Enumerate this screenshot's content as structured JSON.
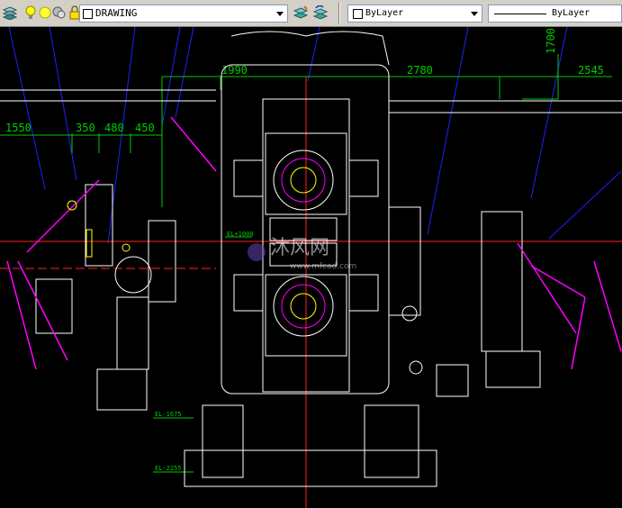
{
  "toolbar": {
    "layer_name": "DRAWING",
    "color_value": "ByLayer",
    "linetype_value": "ByLayer",
    "icons": [
      "layers-icon",
      "lightbulb-icon",
      "sun-icon",
      "freeze-viewport-icon",
      "lock-icon",
      "color-swatch-icon",
      "make-object-layer-current-icon",
      "layer-previous-icon",
      "dropdown-arrow-icon"
    ]
  },
  "drawing": {
    "dimensions": [
      "1550",
      "350",
      "480",
      "450",
      "1990",
      "2780",
      "2545",
      "1700"
    ],
    "elevation_labels": [
      "EL+1000",
      "EL-1675",
      "EL-2255"
    ],
    "watermark_text": "沐风网",
    "watermark_url": "www.mfcad.com",
    "colors": {
      "background": "#000000",
      "dimension": "#00cc00",
      "geometry": "#ffffff",
      "centerline": "#ff2020",
      "leader": "#2020ff",
      "accent": "#ff00ff",
      "yellow": "#ffff00",
      "cyan": "#00ffff"
    }
  }
}
